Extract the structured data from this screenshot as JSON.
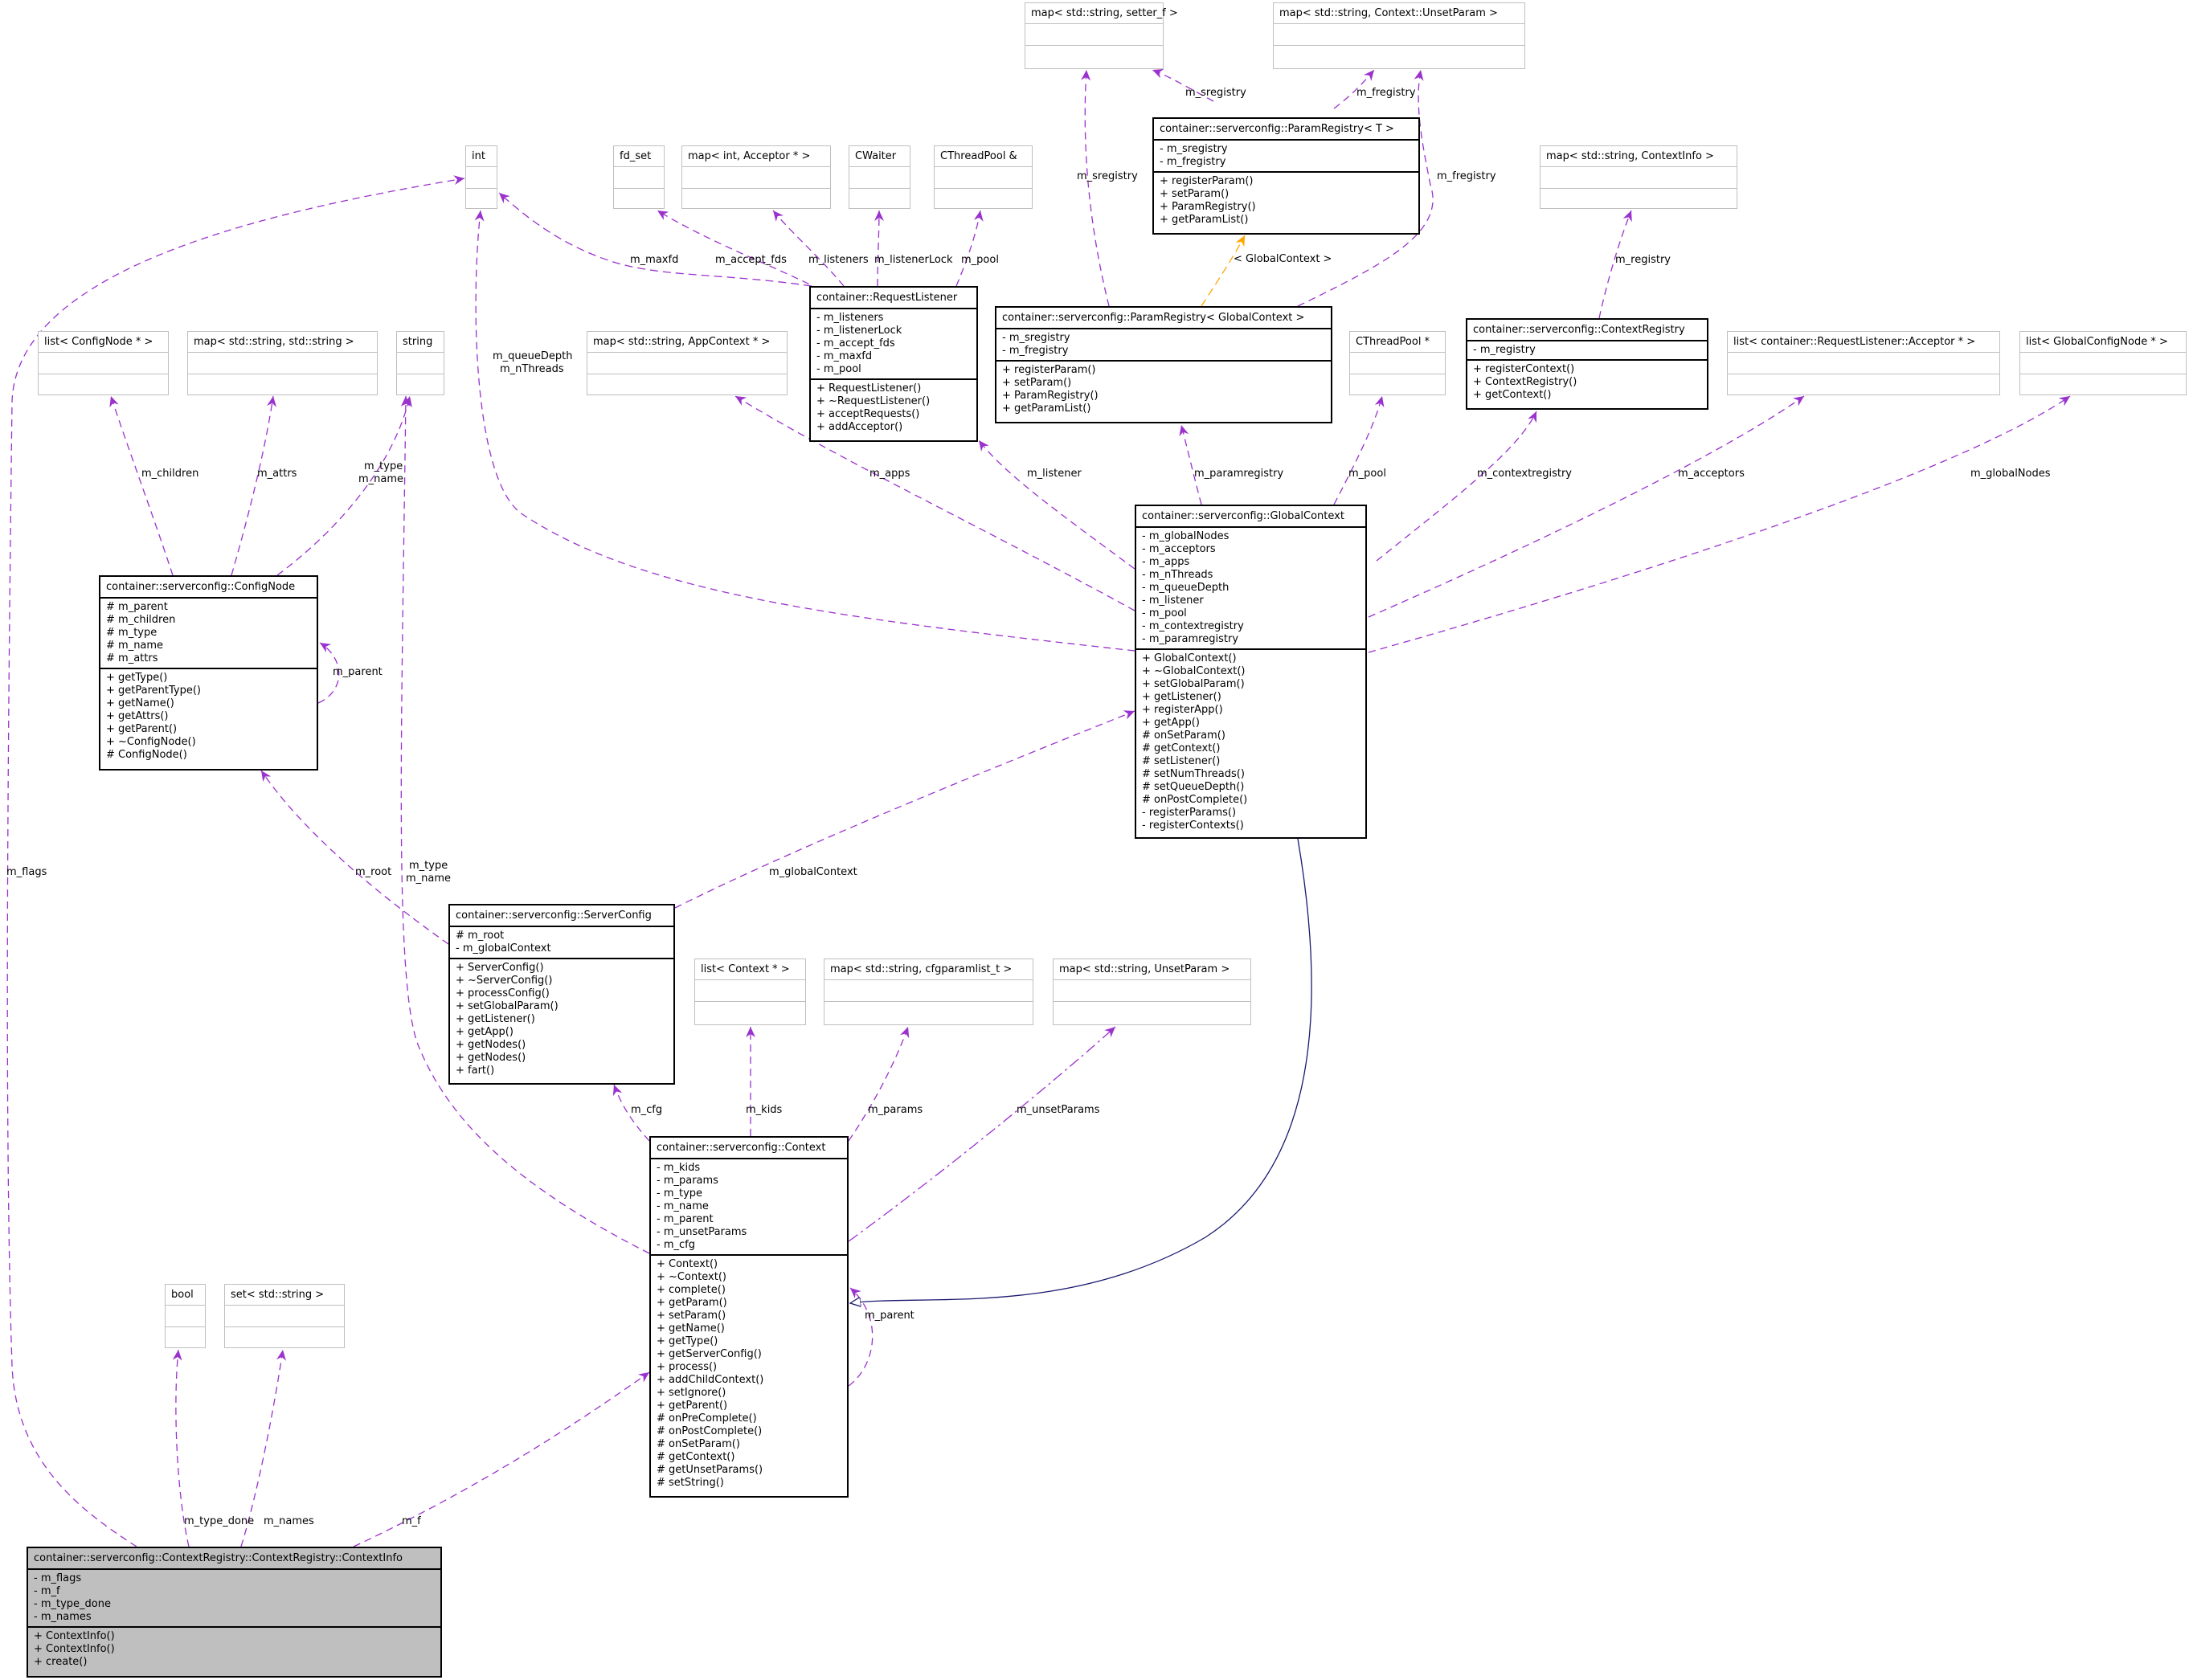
{
  "colors": {
    "composition_edge": "#9a32cd",
    "template_edge": "#ffa500",
    "inheritance_edge": "#191970",
    "box_border": "#000000",
    "external_border": "#bfbfbf",
    "focus_fill": "#bfbfbf"
  },
  "classes": {
    "map_setter": {
      "title": "map< std::string, setter_f >",
      "attrs": [],
      "methods": []
    },
    "map_unset": {
      "title": "map< std::string, Context::UnsetParam >",
      "attrs": [],
      "methods": []
    },
    "param_registry_t": {
      "title": "container::serverconfig::ParamRegistry< T >",
      "attrs": [
        "- m_sregistry",
        "- m_fregistry"
      ],
      "methods": [
        "+ registerParam()",
        "+ setParam()",
        "+ ParamRegistry()",
        "+ getParamList()"
      ]
    },
    "int": {
      "title": "int",
      "attrs": [],
      "methods": []
    },
    "fd_set": {
      "title": "fd_set",
      "attrs": [],
      "methods": []
    },
    "map_acceptor": {
      "title": "map< int, Acceptor * >",
      "attrs": [],
      "methods": []
    },
    "cwaiter": {
      "title": "CWaiter",
      "attrs": [],
      "methods": []
    },
    "cthreadpool_ref": {
      "title": "CThreadPool &",
      "attrs": [],
      "methods": []
    },
    "map_contextinfo": {
      "title": "map< std::string, ContextInfo >",
      "attrs": [],
      "methods": []
    },
    "list_confignode": {
      "title": "list< ConfigNode * >",
      "attrs": [],
      "methods": []
    },
    "map_string_string": {
      "title": "map< std::string, std::string >",
      "attrs": [],
      "methods": []
    },
    "string": {
      "title": "string",
      "attrs": [],
      "methods": []
    },
    "map_appcontext": {
      "title": "map< std::string, AppContext * >",
      "attrs": [],
      "methods": []
    },
    "request_listener": {
      "title": "container::RequestListener",
      "attrs": [
        "- m_listeners",
        "- m_listenerLock",
        "- m_accept_fds",
        "- m_maxfd",
        "- m_pool"
      ],
      "methods": [
        "+ RequestListener()",
        "+ ~RequestListener()",
        "+ acceptRequests()",
        "+ addAcceptor()"
      ]
    },
    "param_registry_gc": {
      "title": "container::serverconfig::ParamRegistry< GlobalContext >",
      "attrs": [
        "- m_sregistry",
        "- m_fregistry"
      ],
      "methods": [
        "+ registerParam()",
        "+ setParam()",
        "+ ParamRegistry()",
        "+ getParamList()"
      ]
    },
    "cthreadpool_ptr": {
      "title": "CThreadPool *",
      "attrs": [],
      "methods": []
    },
    "context_registry": {
      "title": "container::serverconfig::ContextRegistry",
      "attrs": [
        "- m_registry"
      ],
      "methods": [
        "+ registerContext()",
        "+ ContextRegistry()",
        "+ getContext()"
      ]
    },
    "list_acceptor": {
      "title": "list< container::RequestListener::Acceptor * >",
      "attrs": [],
      "methods": []
    },
    "list_globalconfignode": {
      "title": "list< GlobalConfigNode * >",
      "attrs": [],
      "methods": []
    },
    "config_node": {
      "title": "container::serverconfig::ConfigNode",
      "attrs": [
        "# m_parent",
        "# m_children",
        "# m_type",
        "# m_name",
        "# m_attrs"
      ],
      "methods": [
        "+ getType()",
        "+ getParentType()",
        "+ getName()",
        "+ getAttrs()",
        "+ getParent()",
        "+ ~ConfigNode()",
        "# ConfigNode()"
      ]
    },
    "global_context": {
      "title": "container::serverconfig::GlobalContext",
      "attrs": [
        "- m_globalNodes",
        "- m_acceptors",
        "- m_apps",
        "- m_nThreads",
        "- m_queueDepth",
        "- m_listener",
        "- m_pool",
        "- m_contextregistry",
        "- m_paramregistry"
      ],
      "methods": [
        "+ GlobalContext()",
        "+ ~GlobalContext()",
        "+ setGlobalParam()",
        "+ getListener()",
        "+ registerApp()",
        "+ getApp()",
        "# onSetParam()",
        "# getContext()",
        "# setListener()",
        "# setNumThreads()",
        "# setQueueDepth()",
        "# onPostComplete()",
        "- registerParams()",
        "- registerContexts()"
      ]
    },
    "server_config": {
      "title": "container::serverconfig::ServerConfig",
      "attrs": [
        "# m_root",
        "- m_globalContext"
      ],
      "methods": [
        "+ ServerConfig()",
        "+ ~ServerConfig()",
        "+ processConfig()",
        "+ setGlobalParam()",
        "+ getListener()",
        "+ getApp()",
        "+ getNodes()",
        "+ getNodes()",
        "+ fart()"
      ]
    },
    "list_context": {
      "title": "list< Context * >",
      "attrs": [],
      "methods": []
    },
    "map_cfgparamlist": {
      "title": "map< std::string, cfgparamlist_t >",
      "attrs": [],
      "methods": []
    },
    "map_unsetparam": {
      "title": "map< std::string, UnsetParam >",
      "attrs": [],
      "methods": []
    },
    "context": {
      "title": "container::serverconfig::Context",
      "attrs": [
        "- m_kids",
        "- m_params",
        "- m_type",
        "- m_name",
        "- m_parent",
        "- m_unsetParams",
        "- m_cfg"
      ],
      "methods": [
        "+ Context()",
        "+ ~Context()",
        "+ complete()",
        "+ getParam()",
        "+ setParam()",
        "+ getName()",
        "+ getType()",
        "+ getServerConfig()",
        "+ process()",
        "+ addChildContext()",
        "+ setIgnore()",
        "+ getParent()",
        "# onPreComplete()",
        "# onPostComplete()",
        "# onSetParam()",
        "# getContext()",
        "# getUnsetParams()",
        "# setString()"
      ]
    },
    "bool": {
      "title": "bool",
      "attrs": [],
      "methods": []
    },
    "set_string": {
      "title": "set< std::string >",
      "attrs": [],
      "methods": []
    },
    "context_info": {
      "title": "container::serverconfig::ContextRegistry::ContextRegistry::ContextInfo",
      "attrs": [
        "- m_flags",
        "- m_f",
        "- m_type_done",
        "- m_names"
      ],
      "methods": [
        "+ ContextInfo()",
        "+ ContextInfo()",
        "+ create()"
      ]
    }
  },
  "edge_labels": {
    "m_sregistry_top": "m_sregistry",
    "m_fregistry_top": "m_fregistry",
    "m_sregistry_side": "m_sregistry",
    "m_fregistry_side": "m_fregistry",
    "template_arg": "< GlobalContext >",
    "m_maxfd": "m_maxfd",
    "m_accept_fds": "m_accept_fds",
    "m_listeners": "m_listeners",
    "m_listenerLock": "m_listenerLock",
    "m_pool_rl": "m_pool",
    "m_registry": "m_registry",
    "m_queueDepth": "m_queueDepth",
    "m_nThreads": "m_nThreads",
    "m_children": "m_children",
    "m_attrs": "m_attrs",
    "m_type_cn": "m_type",
    "m_name_cn": "m_name",
    "m_apps": "m_apps",
    "m_listener": "m_listener",
    "m_paramregistry": "m_paramregistry",
    "m_pool_gc": "m_pool",
    "m_contextregistry": "m_contextregistry",
    "m_acceptors": "m_acceptors",
    "m_globalNodes": "m_globalNodes",
    "m_parent_cn": "m_parent",
    "m_flags": "m_flags",
    "m_root": "m_root",
    "m_type_ctx": "m_type",
    "m_name_ctx": "m_name",
    "m_globalContext": "m_globalContext",
    "m_cfg": "m_cfg",
    "m_kids": "m_kids",
    "m_params": "m_params",
    "m_unsetParams": "m_unsetParams",
    "m_parent_ctx": "m_parent",
    "m_type_done": "m_type_done",
    "m_names": "m_names",
    "m_f": "m_f"
  }
}
